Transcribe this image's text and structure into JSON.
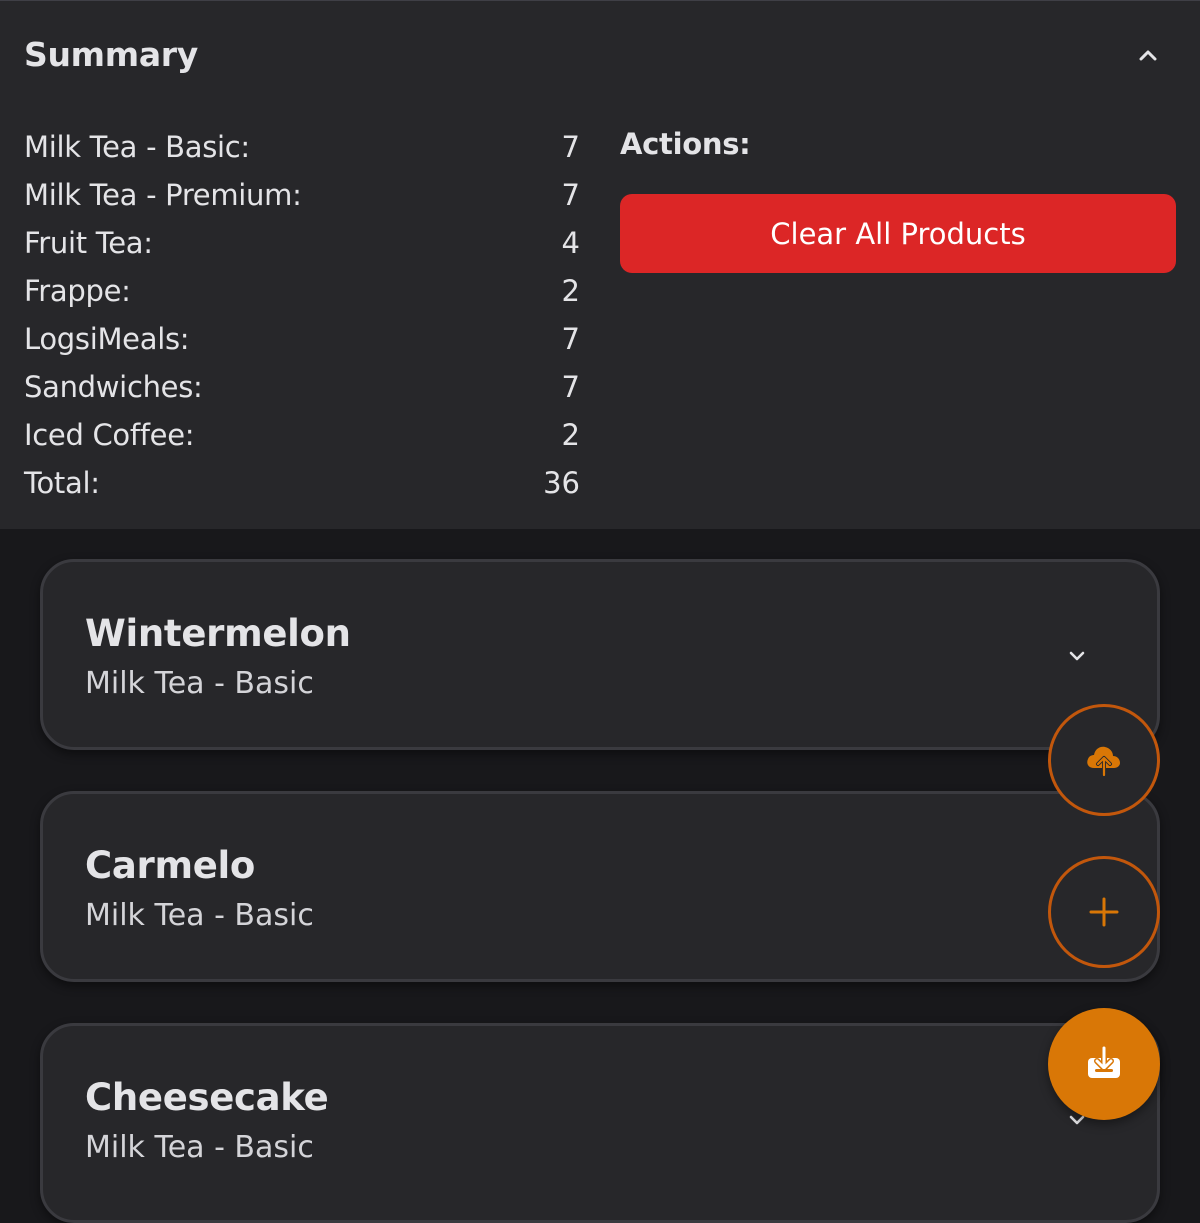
{
  "summary": {
    "title": "Summary",
    "rows": [
      {
        "label": "Milk Tea - Basic:",
        "value": "7"
      },
      {
        "label": "Milk Tea - Premium:",
        "value": "7"
      },
      {
        "label": "Fruit Tea:",
        "value": "4"
      },
      {
        "label": "Frappe:",
        "value": "2"
      },
      {
        "label": "LogsiMeals:",
        "value": "7"
      },
      {
        "label": "Sandwiches:",
        "value": "7"
      },
      {
        "label": "Iced Coffee:",
        "value": "2"
      },
      {
        "label": "Total:",
        "value": "36"
      }
    ],
    "actions_label": "Actions:",
    "clear_button_label": "Clear All Products",
    "collapse_icon": "chevron-up-icon"
  },
  "products": [
    {
      "name": "Wintermelon",
      "category": "Milk Tea - Basic"
    },
    {
      "name": "Carmelo",
      "category": "Milk Tea - Basic"
    },
    {
      "name": "Cheesecake",
      "category": "Milk Tea - Basic"
    }
  ],
  "fab": {
    "upload_icon": "cloud-upload-icon",
    "add_icon": "plus-icon",
    "download_icon": "download-tray-icon"
  },
  "colors": {
    "background": "#18181b",
    "panel": "#27272a",
    "danger": "#dc2626",
    "accent": "#d97706",
    "accent_border": "#c2570c"
  }
}
